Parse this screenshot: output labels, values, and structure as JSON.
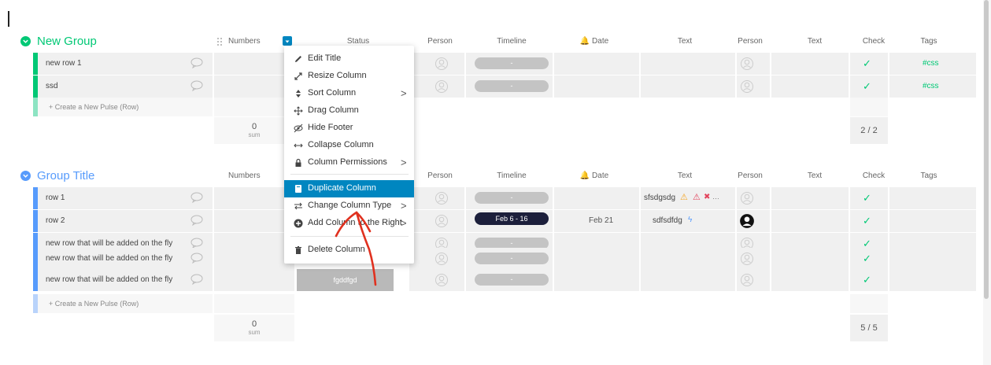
{
  "colors": {
    "green": "#00c875",
    "blue": "#579bfc",
    "accent": "#0086c0",
    "red_annotation": "#e0311f"
  },
  "group1": {
    "title": "New Group",
    "columns": [
      "Numbers",
      "Status",
      "Person",
      "Timeline",
      "Date",
      "Text",
      "Person",
      "Text",
      "Check",
      "Tags"
    ],
    "rows": [
      {
        "name": "new row 1",
        "timeline": "-",
        "tag": "#css"
      },
      {
        "name": "ssd",
        "timeline": "-",
        "tag": "#css"
      }
    ],
    "create_row": "+ Create a New Pulse (Row)",
    "footer": {
      "sum_value": "0",
      "sum_label": "sum",
      "check_count": "2 / 2"
    }
  },
  "group2": {
    "title": "Group Title",
    "columns": [
      "Numbers",
      "Person",
      "Timeline",
      "Date",
      "Text",
      "Person",
      "Text",
      "Check",
      "Tags"
    ],
    "rows": [
      {
        "name": "row 1",
        "timeline": "-",
        "text": "sfsdgsdg"
      },
      {
        "name": "row 2",
        "timeline": "Feb 6 - 16",
        "date": "Feb 21",
        "text": "sdfsdfdg"
      },
      {
        "name": "new row that will be added on the fly",
        "timeline": "-"
      },
      {
        "name": "new row that will be added on the fly",
        "timeline": "-"
      },
      {
        "name": "new row that will be added on the fly",
        "timeline": "-",
        "status": "fgddfgd"
      }
    ],
    "create_row": "+ Create a New Pulse (Row)",
    "footer": {
      "sum_value": "0",
      "sum_label": "sum",
      "check_count": "5 / 5"
    }
  },
  "menu": {
    "items": [
      {
        "label": "Edit Title",
        "icon": "pencil-icon"
      },
      {
        "label": "Resize Column",
        "icon": "resize-icon"
      },
      {
        "label": "Sort Column",
        "icon": "sort-icon",
        "submenu": true
      },
      {
        "label": "Drag Column",
        "icon": "move-icon"
      },
      {
        "label": "Hide Footer",
        "icon": "eye-off-icon"
      },
      {
        "label": "Collapse Column",
        "icon": "collapse-icon"
      },
      {
        "label": "Column Permissions",
        "icon": "lock-icon",
        "submenu": true
      },
      {
        "label": "Duplicate Column",
        "icon": "duplicate-icon",
        "active": true
      },
      {
        "label": "Change Column Type",
        "icon": "swap-icon",
        "submenu": true
      },
      {
        "label": "Add Column to the Right",
        "icon": "plus-circle-icon",
        "submenu": true
      },
      {
        "label": "Delete Column",
        "icon": "trash-icon"
      }
    ],
    "submenu_arrow": ">"
  }
}
